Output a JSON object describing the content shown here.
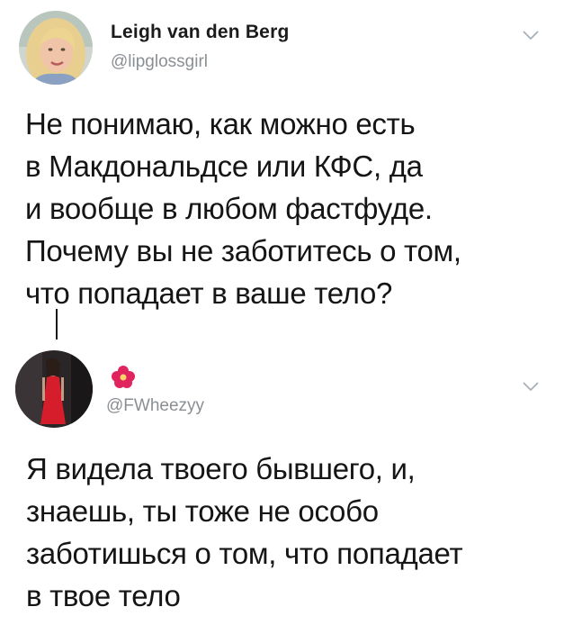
{
  "tweets": [
    {
      "display_name": "Leigh van den Berg",
      "handle": "@lipglossgirl",
      "text": "Не понимаю, как можно есть\nв Макдональдсе или КФС, да\nи вообще в любом фастфуде.\nПочему вы не заботитесь о том,\nчто попадает в ваше тело?"
    },
    {
      "display_name_icon": "flower-emoji",
      "handle": "@FWheezyy",
      "text": "Я видела твоего бывшего, и,\nзнаешь, ты тоже не особо\nзаботишься о том, что попадает\nв твое тело"
    }
  ],
  "colors": {
    "handle": "#8a8f94",
    "text": "#151515",
    "flower": "#e0245e"
  },
  "icons": {
    "menu": "chevron-down-icon",
    "avatar_1": "avatar-blonde-woman",
    "avatar_2": "avatar-woman-red-dress"
  }
}
